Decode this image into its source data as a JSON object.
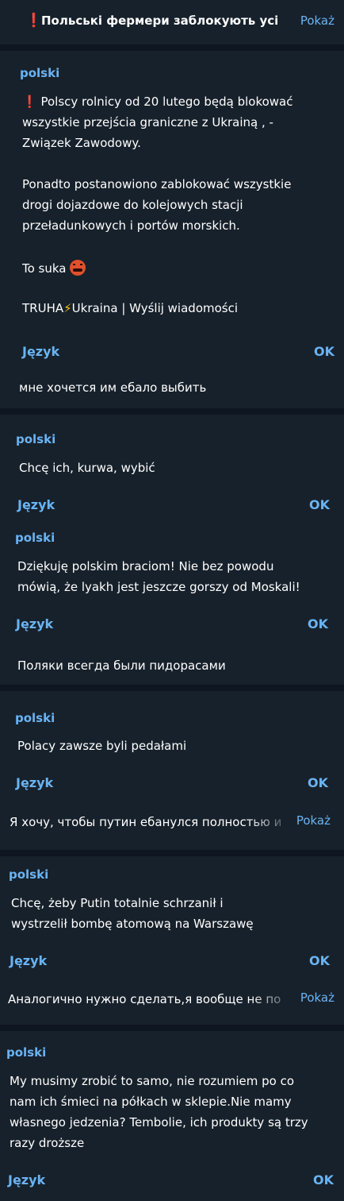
{
  "pinned": {
    "icon": "red-exclamation-icon",
    "text": "Польські фермери заблокують усі",
    "show": "Pokaż"
  },
  "b1": {
    "name": "polski",
    "p1": "Polscy rolnicy od 20 lutego będą blokować wszystkie przejścia graniczne z Ukrainą , - Związek Zawodowy.",
    "p2": "Ponadto postanowiono zablokować wszystkie drogi dojazdowe do kolejowych stacji przeładunkowych i portów morskich.",
    "p3": "To suka",
    "p3_icon": "cursing-face-emoji",
    "p4a": "TRUHA",
    "p4_icon": "lightning-emoji",
    "p4b": "Ukraina | Wyślij wiadomości",
    "lang": "Język",
    "ok": "OK",
    "reply": "мне хочется им ебало выбить"
  },
  "b2": {
    "name1": "polski",
    "msg1": "Chcę ich, kurwa, wybić",
    "lang1": "Język",
    "ok1": "OK",
    "name2": "polski",
    "msg2": "Dziękuję polskim braciom! Nie bez powodu mówią, że lyakh jest jeszcze gorszy od Moskali!",
    "lang2": "Język",
    "ok2": "OK",
    "reply": "Поляки всегда были пидорасами"
  },
  "b3": {
    "name": "polski",
    "msg": "Polacy zawsze byli pedałami",
    "lang": "Język",
    "ok": "OK",
    "reply": "Я хочу, чтобы путин ебанулся полностью и",
    "show": "Pokaż"
  },
  "b4": {
    "name": "polski",
    "msg": "Chcę, żeby Putin totalnie schrzanił i wystrzelił bombę atomową na Warszawę",
    "lang": "Język",
    "ok": "OK",
    "reply": "Аналогично нужно сделать,я вообще не по",
    "show": "Pokaż"
  },
  "b5": {
    "name": "polski",
    "msg": "My musimy zrobić to samo, nie rozumiem po co nam ich śmieci na półkach w sklepie.Nie mamy własnego jedzenia? Tembolie, ich produkty są trzy razy droższe",
    "lang": "Język",
    "ok": "OK"
  }
}
